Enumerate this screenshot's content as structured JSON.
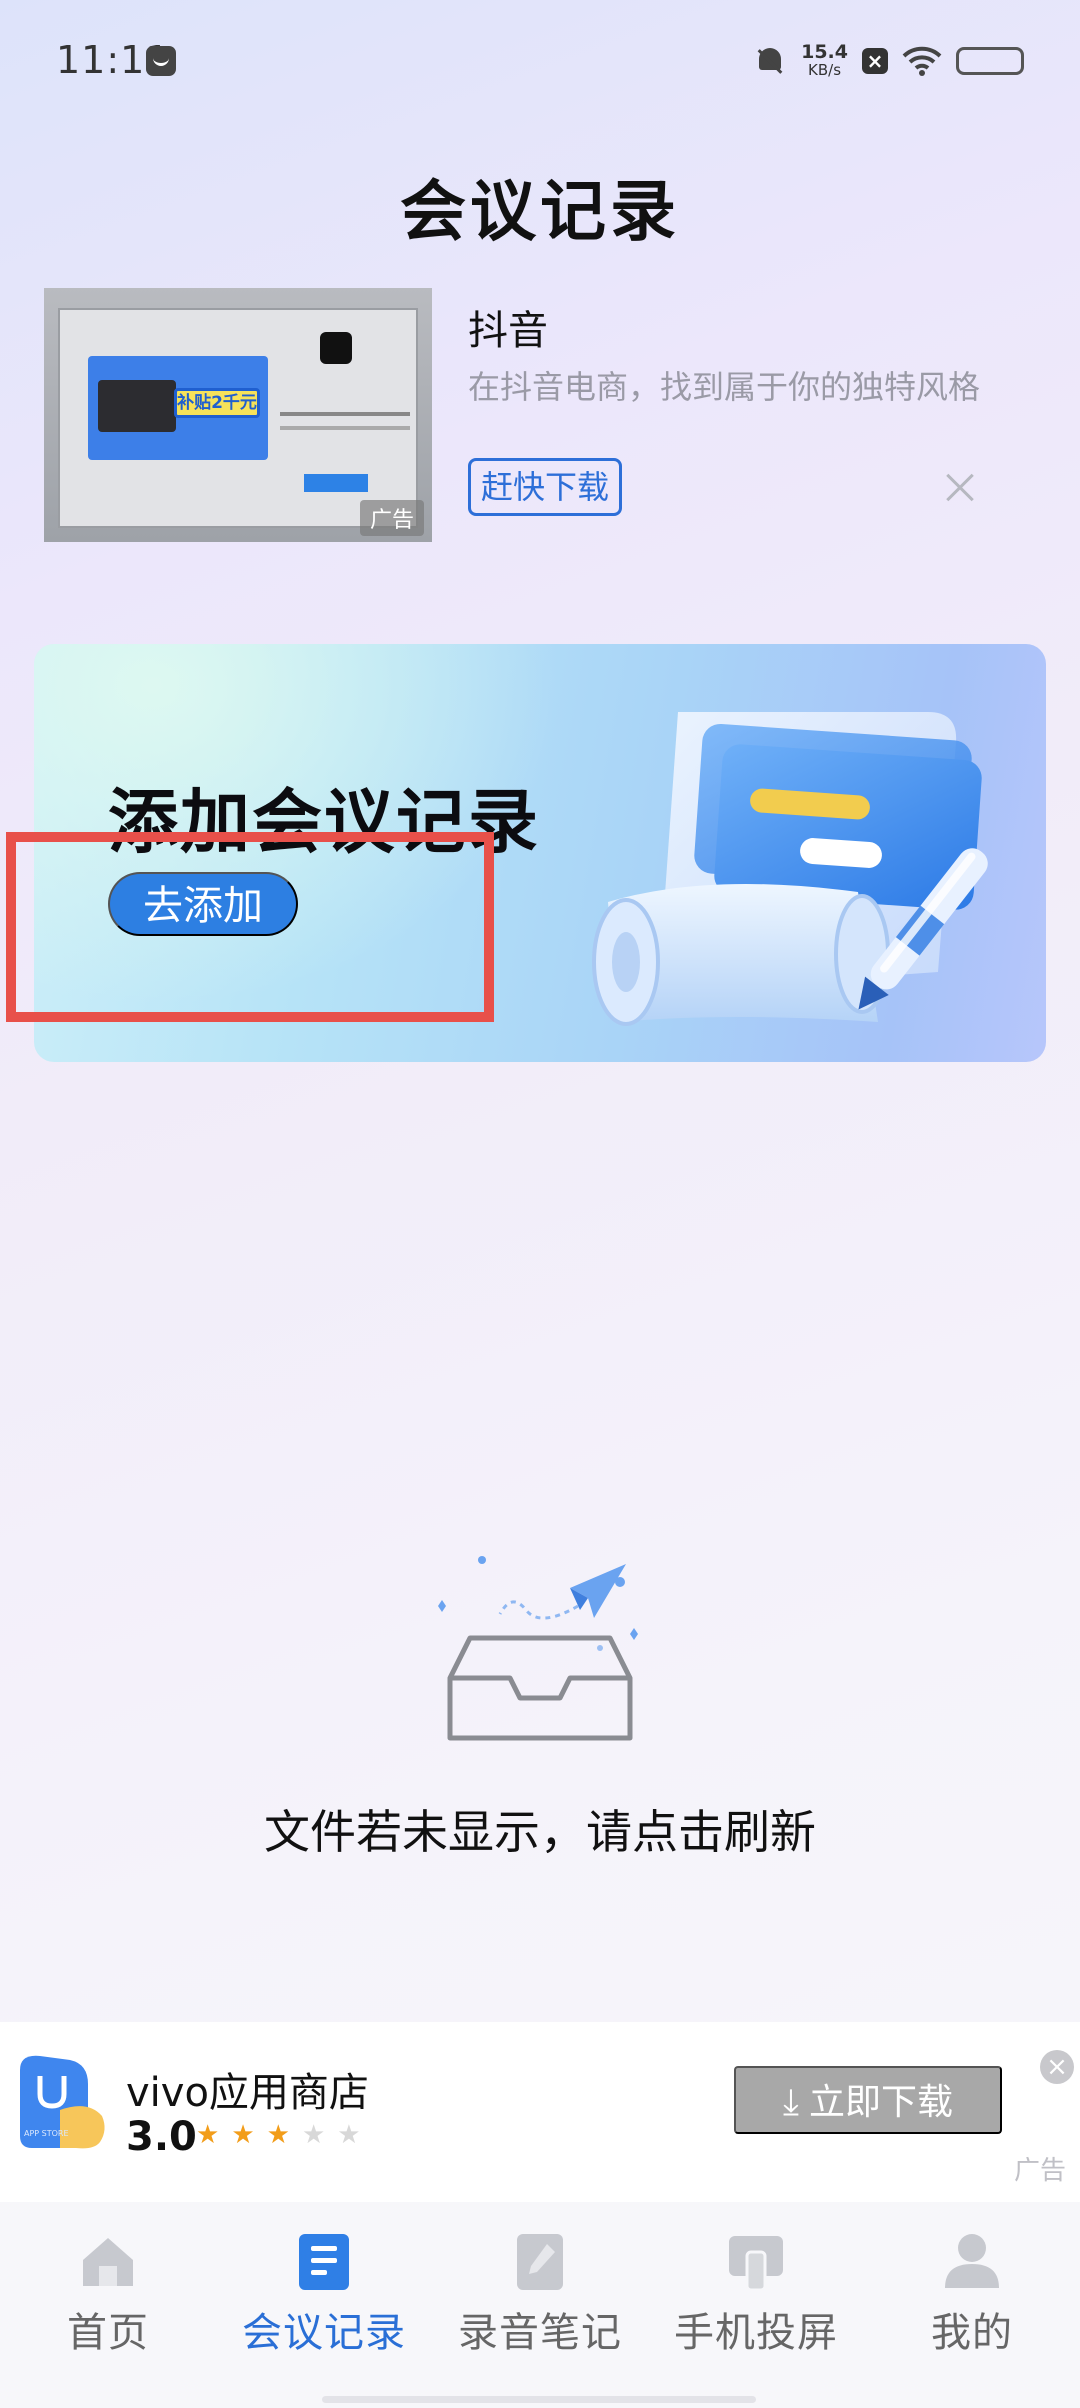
{
  "status_bar": {
    "time": "11:11",
    "net_speed_value": "15.4",
    "net_speed_unit": "KB/s",
    "icons": [
      "mail-icon",
      "bell-muted-icon",
      "box-x-icon",
      "wifi-icon",
      "battery-icon"
    ]
  },
  "page_title": "会议记录",
  "ad_top": {
    "app_name": "抖音",
    "description": "在抖音电商，找到属于你的独特风格",
    "cta": "赶快下载",
    "tag": "广告",
    "thumb_badge": "补贴2千元"
  },
  "banner": {
    "title": "添加会议记录",
    "button": "去添加"
  },
  "empty_state": {
    "text": "文件若未显示，请点击刷新"
  },
  "ad_bottom": {
    "app_name": "vivo应用商店",
    "rating": "3.0",
    "stars_filled": 3,
    "stars_total": 5,
    "cta": "立即下载",
    "tag": "广告",
    "icon_label": "APP STORE"
  },
  "bottom_nav": {
    "items": [
      {
        "label": "首页",
        "icon": "home-icon",
        "active": false
      },
      {
        "label": "会议记录",
        "icon": "document-icon",
        "active": true
      },
      {
        "label": "录音笔记",
        "icon": "note-icon",
        "active": false
      },
      {
        "label": "手机投屏",
        "icon": "cast-icon",
        "active": false
      },
      {
        "label": "我的",
        "icon": "profile-icon",
        "active": false
      }
    ]
  },
  "colors": {
    "accent": "#2a6fd6",
    "banner_button": "#2d7fe2",
    "highlight": "#e8504a",
    "star": "#f29d1a"
  }
}
